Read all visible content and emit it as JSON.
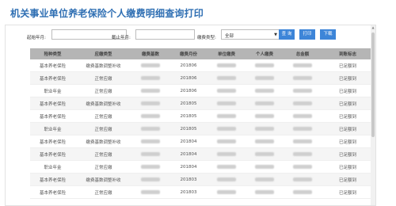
{
  "page": {
    "title": "机关事业单位养老保险个人缴费明细查询打印"
  },
  "filters": {
    "start_label": "起始年月:",
    "start_value": "",
    "end_label": "截止年月:",
    "end_value": "",
    "type_label": "缴费类型:",
    "type_value": "全部",
    "search_label": "查 询",
    "print_label": "打印",
    "download_label": "下载"
  },
  "table": {
    "headers": [
      "险种类型",
      "应缴类型",
      "缴费基数",
      "缴费月份",
      "单位缴费",
      "个人缴费",
      "总金额",
      "到账标志"
    ],
    "rows": [
      {
        "c1": "基本养老保险",
        "c2": "缴费基数调整补收",
        "c4": "201806",
        "c8": "已足额到"
      },
      {
        "c1": "基本养老保险",
        "c2": "正常应缴",
        "c4": "201806",
        "c8": "已足额到"
      },
      {
        "c1": "职业年金",
        "c2": "正常应缴",
        "c4": "201806",
        "c8": "已足额到"
      },
      {
        "c1": "基本养老保险",
        "c2": "缴费基数调整补收",
        "c4": "201805",
        "c8": "已足额到"
      },
      {
        "c1": "基本养老保险",
        "c2": "正常应缴",
        "c4": "201805",
        "c8": "已足额到"
      },
      {
        "c1": "职业年金",
        "c2": "正常应缴",
        "c4": "201805",
        "c8": "已足额到"
      },
      {
        "c1": "基本养老保险",
        "c2": "缴费基数调整补收",
        "c4": "201804",
        "c8": "已足额到"
      },
      {
        "c1": "基本养老保险",
        "c2": "正常应缴",
        "c4": "201804",
        "c8": "已足额到"
      },
      {
        "c1": "职业年金",
        "c2": "正常应缴",
        "c4": "201804",
        "c8": "已足额到"
      },
      {
        "c1": "基本养老保险",
        "c2": "缴费基数调整补收",
        "c4": "201803",
        "c8": "已足额到"
      },
      {
        "c1": "基本养老保险",
        "c2": "正常应缴",
        "c4": "201803",
        "c8": "已足额到"
      }
    ]
  },
  "icons": {
    "dropdown": "chevron-down-icon",
    "scroll_up": "arrow-up-icon",
    "scroll_down": "arrow-down-icon"
  },
  "colors": {
    "title": "#2f6fb3",
    "button": "#3d85d8",
    "header_bg": "#b5b5b5"
  }
}
